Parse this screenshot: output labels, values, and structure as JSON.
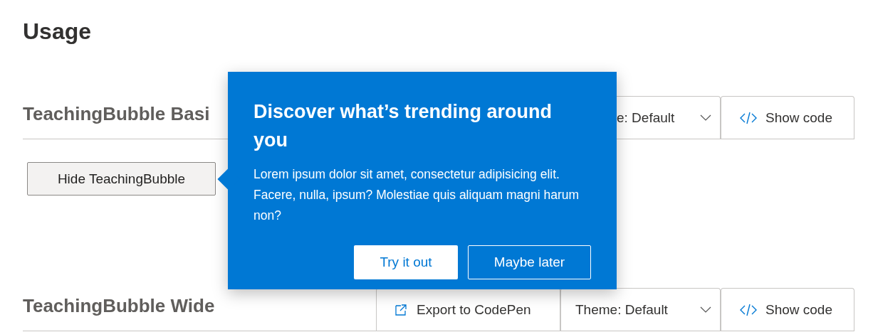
{
  "heading": "Usage",
  "sections": [
    {
      "title": "TeachingBubble Basi",
      "toolbar": [
        {
          "kind": "dropdown",
          "label": "e: Default",
          "cut": true
        },
        {
          "kind": "code",
          "label": "Show code"
        }
      ],
      "button": "Hide TeachingBubble"
    },
    {
      "title": "TeachingBubble Wide",
      "toolbar": [
        {
          "kind": "export",
          "label": "Export to CodePen"
        },
        {
          "kind": "dropdown",
          "label": "Theme: Default"
        },
        {
          "kind": "code",
          "label": "Show code"
        }
      ]
    }
  ],
  "bubble": {
    "title": "Discover what’s trending around you",
    "body": "Lorem ipsum dolor sit amet, consectetur adipisicing elit. Facere, nulla, ipsum? Molestiae quis aliquam magni harum non?",
    "primary": "Try it out",
    "secondary": "Maybe later"
  }
}
